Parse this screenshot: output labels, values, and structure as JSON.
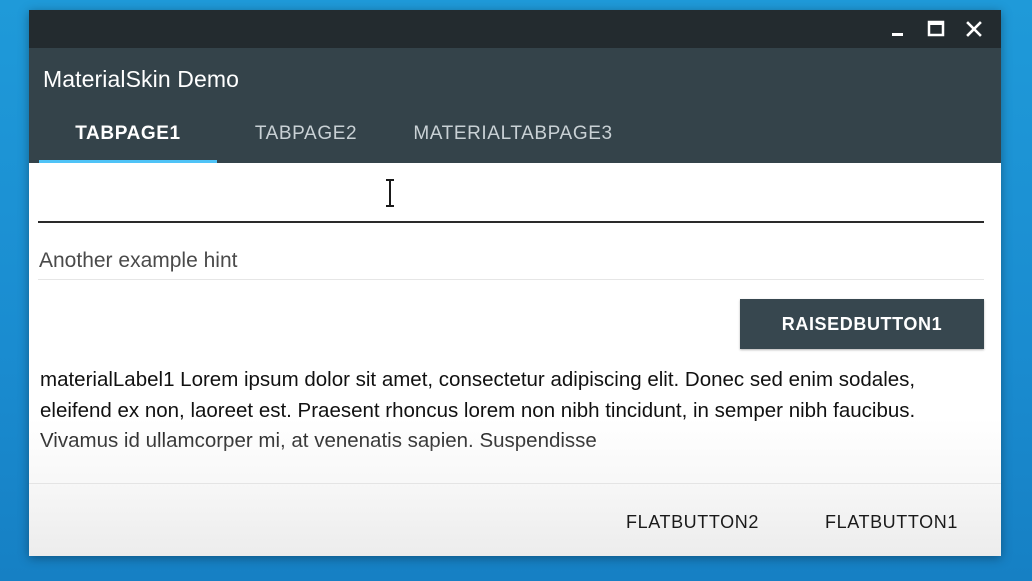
{
  "window": {
    "controls": {
      "minimize_icon": "minimize-icon",
      "maximize_icon": "maximize-icon",
      "close_icon": "close-icon"
    }
  },
  "header": {
    "title": "MaterialSkin Demo",
    "tabs": [
      {
        "label": "TABPAGE1",
        "active": true
      },
      {
        "label": "TABPAGE2",
        "active": false
      },
      {
        "label": "MATERIALTABPAGE3",
        "active": false
      }
    ]
  },
  "form": {
    "text_field_1": {
      "value": "",
      "placeholder": ""
    },
    "text_field_2": {
      "value": "",
      "hint": "Another example hint"
    },
    "raised_button_label": "RAISEDBUTTON1",
    "label_text": "materialLabel1 Lorem ipsum dolor sit amet, consectetur adipiscing elit. Donec sed enim sodales, eleifend ex non, laoreet est. Praesent rhoncus lorem non nibh tincidunt, in semper nibh faucibus. Vivamus id ullamcorper mi, at venenatis sapien. Suspendisse"
  },
  "footer": {
    "flat_button_2": "FLATBUTTON2",
    "flat_button_1": "FLATBUTTON1"
  },
  "colors": {
    "desktop": "#1e94d4",
    "titlebar": "#232b2f",
    "primary": "#34434a",
    "accent": "#4fc3f7"
  }
}
